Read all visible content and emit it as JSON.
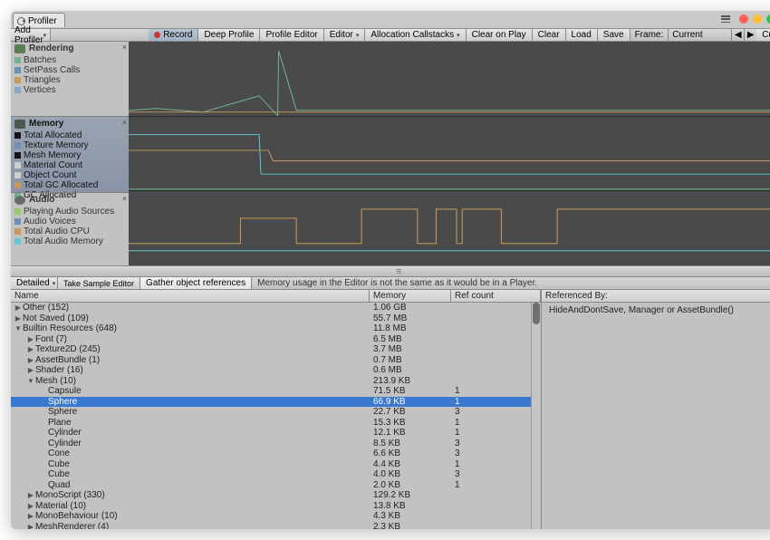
{
  "window": {
    "tab": "Profiler"
  },
  "toolbar": {
    "addProfiler": "Add Profiler",
    "record": "Record",
    "deepProfile": "Deep Profile",
    "profileEditor": "Profile Editor",
    "editor": "Editor",
    "allocCallstacks": "Allocation Callstacks",
    "clearOnPlay": "Clear on Play",
    "clear": "Clear",
    "load": "Load",
    "save": "Save",
    "frameLabel": "Frame:",
    "frameValue": "Current",
    "prev": "◀",
    "next": "▶",
    "current": "Current"
  },
  "categories": {
    "rendering": {
      "title": "Rendering",
      "items": [
        {
          "label": "Batches",
          "color": "#6fb38a"
        },
        {
          "label": "SetPass Calls",
          "color": "#6d8fb5"
        },
        {
          "label": "Triangles",
          "color": "#c79a5b"
        },
        {
          "label": "Vertices",
          "color": "#8aa7c8"
        }
      ]
    },
    "memory": {
      "title": "Memory",
      "items": [
        {
          "label": "Total Allocated",
          "color": "#151515"
        },
        {
          "label": "Texture Memory",
          "color": "#6d8fb5"
        },
        {
          "label": "Mesh Memory",
          "color": "#151515"
        },
        {
          "label": "Material Count",
          "color": "#cfcfcf"
        },
        {
          "label": "Object Count",
          "color": "#cfcfcf"
        },
        {
          "label": "Total GC Allocated",
          "color": "#c79a5b"
        },
        {
          "label": "GC Allocated",
          "color": "#6fb38a"
        }
      ]
    },
    "audio": {
      "title": "Audio",
      "items": [
        {
          "label": "Playing Audio Sources",
          "color": "#9ec96a"
        },
        {
          "label": "Audio Voices",
          "color": "#6d8fb5"
        },
        {
          "label": "Total Audio CPU",
          "color": "#c79a5b"
        },
        {
          "label": "Total Audio Memory",
          "color": "#65c8d0"
        }
      ]
    }
  },
  "bottomToolbar": {
    "detailed": "Detailed",
    "takeSample": "Take Sample Editor",
    "gather": "Gather object references",
    "hint": "Memory usage in the Editor is not the same as it would be in a Player."
  },
  "columns": {
    "name": "Name",
    "memory": "Memory",
    "ref": "Ref count"
  },
  "refPane": {
    "header": "Referenced By:",
    "text": "HideAndDontSave, Manager or AssetBundle()"
  },
  "rows": [
    {
      "indent": 0,
      "arrow": "right",
      "name": "Other (152)",
      "mem": "1.06 GB",
      "ref": ""
    },
    {
      "indent": 0,
      "arrow": "right",
      "name": "Not Saved (109)",
      "mem": "55.7 MB",
      "ref": ""
    },
    {
      "indent": 0,
      "arrow": "down",
      "name": "Builtin Resources (648)",
      "mem": "11.8 MB",
      "ref": ""
    },
    {
      "indent": 1,
      "arrow": "right",
      "name": "Font (7)",
      "mem": "6.5 MB",
      "ref": ""
    },
    {
      "indent": 1,
      "arrow": "right",
      "name": "Texture2D (245)",
      "mem": "3.7 MB",
      "ref": ""
    },
    {
      "indent": 1,
      "arrow": "right",
      "name": "AssetBundle (1)",
      "mem": "0.7 MB",
      "ref": ""
    },
    {
      "indent": 1,
      "arrow": "right",
      "name": "Shader (16)",
      "mem": "0.6 MB",
      "ref": ""
    },
    {
      "indent": 1,
      "arrow": "down",
      "name": "Mesh (10)",
      "mem": "213.9 KB",
      "ref": ""
    },
    {
      "indent": 2,
      "arrow": "",
      "name": "Capsule",
      "mem": "71.5 KB",
      "ref": "1"
    },
    {
      "indent": 2,
      "arrow": "",
      "name": "Sphere",
      "mem": "66.9 KB",
      "ref": "1",
      "sel": true
    },
    {
      "indent": 2,
      "arrow": "",
      "name": "Sphere",
      "mem": "22.7 KB",
      "ref": "3"
    },
    {
      "indent": 2,
      "arrow": "",
      "name": "Plane",
      "mem": "15.3 KB",
      "ref": "1"
    },
    {
      "indent": 2,
      "arrow": "",
      "name": "Cylinder",
      "mem": "12.1 KB",
      "ref": "1"
    },
    {
      "indent": 2,
      "arrow": "",
      "name": "Cylinder",
      "mem": "8.5 KB",
      "ref": "3"
    },
    {
      "indent": 2,
      "arrow": "",
      "name": "Cone",
      "mem": "6.6 KB",
      "ref": "3"
    },
    {
      "indent": 2,
      "arrow": "",
      "name": "Cube",
      "mem": "4.4 KB",
      "ref": "1"
    },
    {
      "indent": 2,
      "arrow": "",
      "name": "Cube",
      "mem": "4.0 KB",
      "ref": "3"
    },
    {
      "indent": 2,
      "arrow": "",
      "name": "Quad",
      "mem": "2.0 KB",
      "ref": "1"
    },
    {
      "indent": 1,
      "arrow": "right",
      "name": "MonoScript (330)",
      "mem": "129.2 KB",
      "ref": ""
    },
    {
      "indent": 1,
      "arrow": "right",
      "name": "Material (10)",
      "mem": "13.8 KB",
      "ref": ""
    },
    {
      "indent": 1,
      "arrow": "right",
      "name": "MonoBehaviour (10)",
      "mem": "4.3 KB",
      "ref": ""
    },
    {
      "indent": 1,
      "arrow": "right",
      "name": "MeshRenderer (4)",
      "mem": "2.3 KB",
      "ref": ""
    }
  ]
}
